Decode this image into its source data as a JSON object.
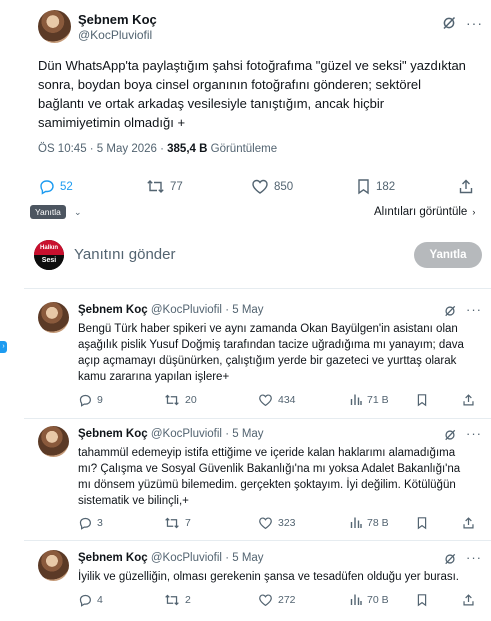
{
  "main": {
    "name": "Şebnem Koç",
    "handle": "@KocPluviofil",
    "text": "Dün WhatsApp'ta paylaştığım şahsi fotoğrafıma \"güzel ve seksi\" yazdıktan sonra, boydan boya cinsel organının fotoğrafını gönderen; sektörel bağlantı ve ortak arkadaş vesilesiyle tanıştığım, ancak hiçbir samimiyetimin olmadığı",
    "more_sign": "+",
    "time": "ÖS 10:45 · 5 May 2026 ·",
    "views_count": "385,4 B",
    "views_label": "Görüntüleme",
    "replies": "52",
    "reposts": "77",
    "likes": "850",
    "bookmarks": "182",
    "more_dots": "···"
  },
  "tooltip": {
    "label": "Yanıtla",
    "chevron": "⌄"
  },
  "sort": {
    "label": "Alıntıları görüntüle",
    "chevron": "›"
  },
  "compose": {
    "avatar_top": "Halkın",
    "avatar_bottom": "Sesi",
    "placeholder": "Yanıtını gönder",
    "button": "Yanıtla"
  },
  "side_marker": "›",
  "replies": [
    {
      "name": "Şebnem Koç",
      "handle": "@KocPluviofil",
      "time": "· 5 May",
      "text": "Bengü Türk haber spikeri ve aynı zamanda Okan Bayülgen'in asistanı olan aşağılık pislik Yusuf Doğmiş tarafından tacize uğradığıma mı yanayım; dava açıp açmamayı düşünürken, çalıştığım yerde bir gazeteci ve yurttaş olarak kamu zararına yapılan işlere+",
      "replies": "9",
      "reposts": "20",
      "likes": "434",
      "views": "71 B",
      "more": "···"
    },
    {
      "name": "Şebnem Koç",
      "handle": "@KocPluviofil",
      "time": "· 5 May",
      "text": "tahammül edemeyip istifa ettiğime ve içeride kalan haklarımı alamadığıma mı? Çalışma ve Sosyal Güvenlik Bakanlığı'na mı yoksa Adalet Bakanlığı'na mı dönsem yüzümü bilemedim. gerçekten şoktayım. İyi değilim. Kötülüğün sistematik ve bilinçli,+",
      "replies": "3",
      "reposts": "7",
      "likes": "323",
      "views": "78 B",
      "more": "···"
    },
    {
      "name": "Şebnem Koç",
      "handle": "@KocPluviofil",
      "time": "· 5 May",
      "text": "İyilik ve güzelliğin, olması gerekenin şansa ve tesadüfen olduğu yer burası.",
      "replies": "4",
      "reposts": "2",
      "likes": "272",
      "views": "70 B",
      "more": "···"
    }
  ]
}
